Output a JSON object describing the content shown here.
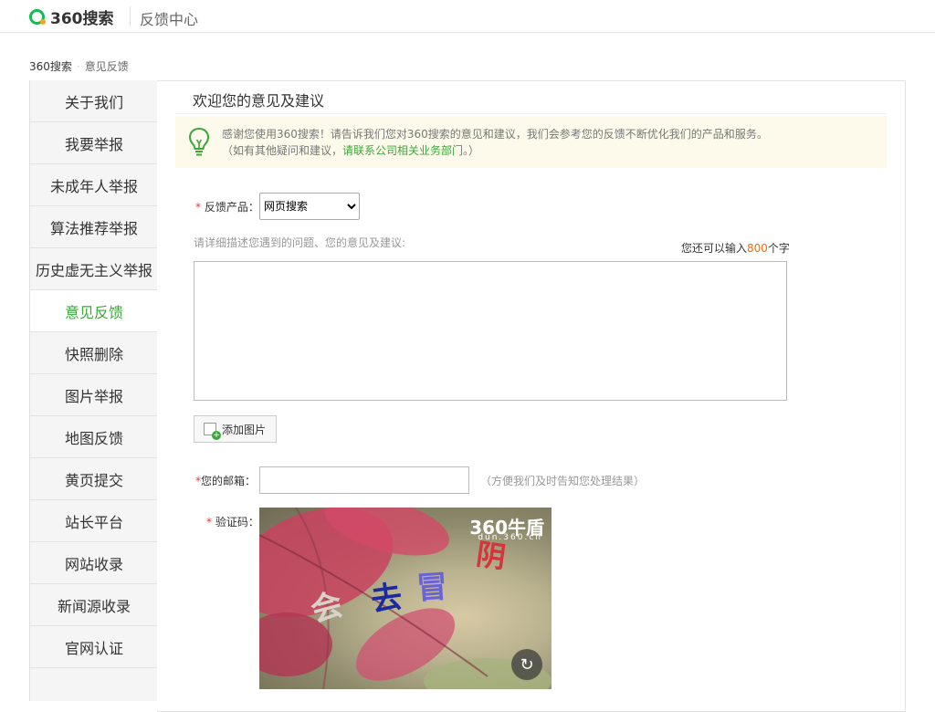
{
  "header": {
    "logo_text": "360搜索",
    "section_title": "反馈中心"
  },
  "breadcrumb": {
    "home": "360搜索",
    "current": "意见反馈"
  },
  "sidebar": {
    "items": [
      {
        "label": "关于我们"
      },
      {
        "label": "我要举报"
      },
      {
        "label": "未成年人举报"
      },
      {
        "label": "算法推荐举报"
      },
      {
        "label": "历史虚无主义举报"
      },
      {
        "label": "意见反馈",
        "active": true
      },
      {
        "label": "快照删除"
      },
      {
        "label": "图片举报"
      },
      {
        "label": "地图反馈"
      },
      {
        "label": "黄页提交"
      },
      {
        "label": "站长平台"
      },
      {
        "label": "网站收录"
      },
      {
        "label": "新闻源收录"
      },
      {
        "label": "官网认证"
      }
    ]
  },
  "main": {
    "title": "欢迎您的意见及建议",
    "notice": {
      "line1": "感谢您使用360搜索！请告诉我们您对360搜索的意见和建议，我们会参考您的反馈不断优化我们的产品和服务。",
      "line2_prefix": "（如有其他疑问和建议，",
      "line2_link": "请联系公司相关业务部门",
      "line2_suffix": "。）"
    },
    "product": {
      "required_mark": "*",
      "label": "反馈产品：",
      "selected": "网页搜索"
    },
    "description": {
      "hint": "请详细描述您遇到的问题、您的意见及建议:",
      "counter_prefix": "您还可以输入",
      "counter_value": "800",
      "counter_suffix": "个字"
    },
    "add_image_label": "添加图片",
    "email": {
      "required_mark": "*",
      "label": "您的邮箱：",
      "hint": "（方便我们及时告知您处理结果）"
    },
    "captcha": {
      "required_mark": "*",
      "label": "验证码：",
      "brand": "360牛盾",
      "brand_sub": "dun.360.cn",
      "chars": [
        "会",
        "去",
        "冒",
        "阴"
      ]
    }
  },
  "colors": {
    "accent_green": "#3aa83a",
    "required_red": "#ee3333",
    "counter_orange": "#ff6600",
    "notice_bg": "#fdfaeb"
  }
}
